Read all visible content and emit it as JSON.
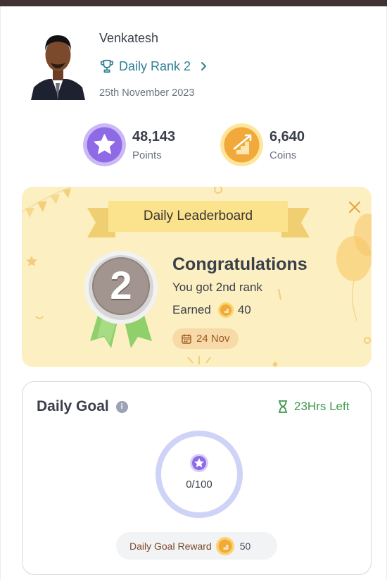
{
  "profile": {
    "name": "Venkatesh",
    "rank_label": "Daily Rank 2",
    "date": "25th November 2023"
  },
  "stats": {
    "points": {
      "value": "48,143",
      "label": "Points",
      "icon": "star-icon"
    },
    "coins": {
      "value": "6,640",
      "label": "Coins",
      "icon": "stairs-coin-icon"
    }
  },
  "leaderboard": {
    "title": "Daily Leaderboard",
    "medal_rank": "2",
    "heading": "Congratulations",
    "subtext": "You got 2nd rank",
    "earned_label": "Earned",
    "earned_value": "40",
    "date_pill": "24 Nov"
  },
  "daily_goal": {
    "title": "Daily Goal",
    "info": "i",
    "time_left": "23Hrs Left",
    "progress_text": "0/100",
    "progress_fraction": 0,
    "reward_label": "Daily Goal Reward",
    "reward_value": "50"
  },
  "colors": {
    "accent_teal": "#2f7f95",
    "card_yellow": "#fcefc2",
    "timer_green": "#3d9a4f",
    "ring": "#cfd3f7",
    "points_purple": "#8f6ae6",
    "coin_orange": "#f5b335"
  }
}
